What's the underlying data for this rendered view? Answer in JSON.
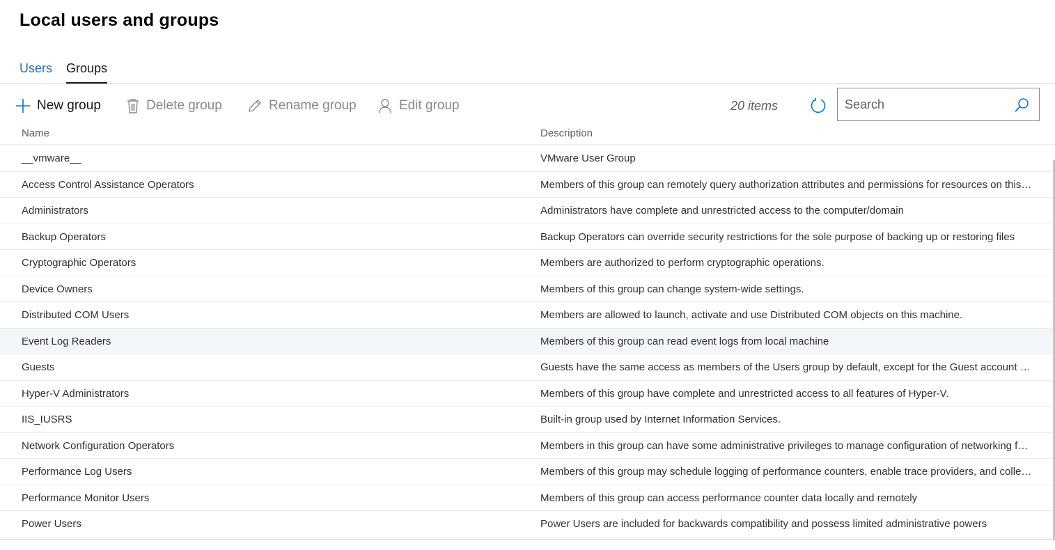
{
  "page": {
    "title": "Local users and groups"
  },
  "tabs": [
    {
      "label": "Users",
      "active": false
    },
    {
      "label": "Groups",
      "active": true
    }
  ],
  "toolbar": {
    "new_group": "New group",
    "delete_group": "Delete group",
    "rename_group": "Rename group",
    "edit_group": "Edit group",
    "item_count": "20 items",
    "search_placeholder": "Search",
    "search_value": ""
  },
  "icons": {
    "new": "plus-icon",
    "delete": "trash-icon",
    "rename": "pencil-icon",
    "edit": "person-icon",
    "refresh": "refresh-icon",
    "search": "search-icon"
  },
  "colors": {
    "accent": "#0078d4",
    "tab_link": "#2b6ca3",
    "disabled_text": "#8a8886",
    "row_highlight": "#f3f7fb"
  },
  "table": {
    "columns": [
      "Name",
      "Description"
    ],
    "rows": [
      {
        "name": "__vmware__",
        "description": "VMware User Group"
      },
      {
        "name": "Access Control Assistance Operators",
        "description": "Members of this group can remotely query authorization attributes and permissions for resources on this…"
      },
      {
        "name": "Administrators",
        "description": "Administrators have complete and unrestricted access to the computer/domain"
      },
      {
        "name": "Backup Operators",
        "description": "Backup Operators can override security restrictions for the sole purpose of backing up or restoring files"
      },
      {
        "name": "Cryptographic Operators",
        "description": "Members are authorized to perform cryptographic operations."
      },
      {
        "name": "Device Owners",
        "description": "Members of this group can change system-wide settings."
      },
      {
        "name": "Distributed COM Users",
        "description": "Members are allowed to launch, activate and use Distributed COM objects on this machine."
      },
      {
        "name": "Event Log Readers",
        "description": "Members of this group can read event logs from local machine",
        "highlighted": true
      },
      {
        "name": "Guests",
        "description": "Guests have the same access as members of the Users group by default, except for the Guest account wh…"
      },
      {
        "name": "Hyper-V Administrators",
        "description": "Members of this group have complete and unrestricted access to all features of Hyper-V."
      },
      {
        "name": "IIS_IUSRS",
        "description": "Built-in group used by Internet Information Services."
      },
      {
        "name": "Network Configuration Operators",
        "description": "Members in this group can have some administrative privileges to manage configuration of networking f…"
      },
      {
        "name": "Performance Log Users",
        "description": "Members of this group may schedule logging of performance counters, enable trace providers, and colle…"
      },
      {
        "name": "Performance Monitor Users",
        "description": "Members of this group can access performance counter data locally and remotely"
      },
      {
        "name": "Power Users",
        "description": "Power Users are included for backwards compatibility and possess limited administrative powers"
      }
    ]
  }
}
